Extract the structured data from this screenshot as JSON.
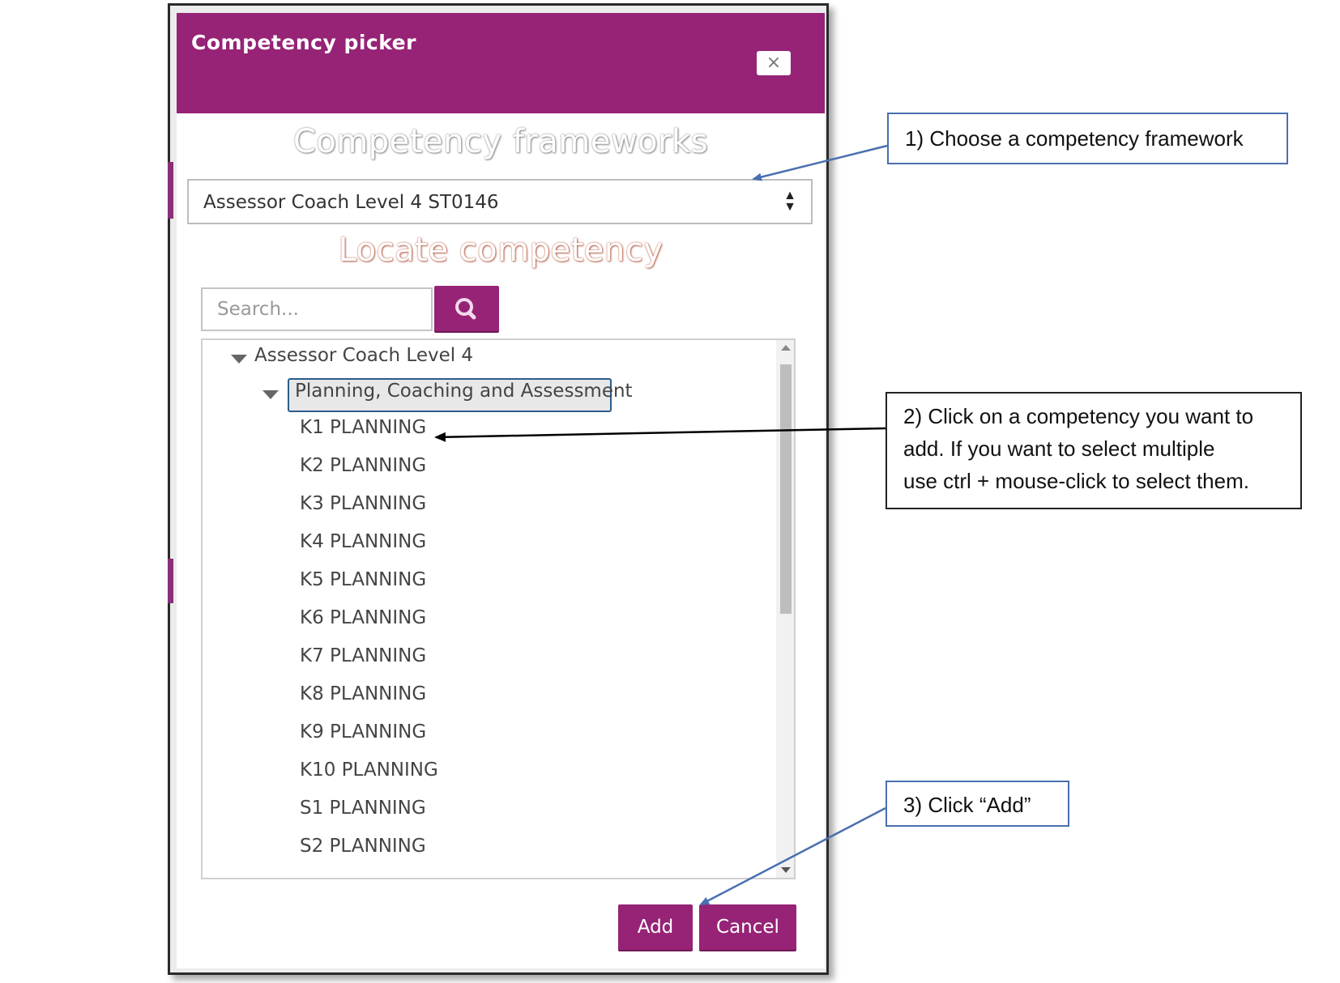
{
  "dialog": {
    "title": "Competency picker",
    "close_label": "×",
    "frameworks_heading": "Competency frameworks",
    "framework_select": {
      "selected": "Assessor Coach Level 4 ST0146"
    },
    "locate_heading": "Locate competency",
    "search": {
      "placeholder": "Search..."
    },
    "search_button_icon": "search-icon",
    "tree": {
      "root": "Assessor Coach Level 4",
      "group": "Planning, Coaching and Assessment",
      "items": [
        "K1 PLANNING",
        "K2 PLANNING",
        "K3 PLANNING",
        "K4 PLANNING",
        "K5 PLANNING",
        "K6 PLANNING",
        "K7 PLANNING",
        "K8 PLANNING",
        "K9 PLANNING",
        "K10 PLANNING",
        "S1 PLANNING",
        "S2 PLANNING"
      ]
    },
    "buttons": {
      "add": "Add",
      "cancel": "Cancel"
    },
    "colors": {
      "primary": "#962376",
      "selection_border": "#2b5d8c"
    }
  },
  "callouts": {
    "step1": "1) Choose a competency framework",
    "step2_lines": [
      "2) Click on a competency you want to",
      "add. If you want to select multiple",
      "use ctrl + mouse-click to select them."
    ],
    "step3": "3) Click “Add”",
    "colors": {
      "blue_border": "#4a6fb0",
      "black_border": "#222222"
    }
  }
}
